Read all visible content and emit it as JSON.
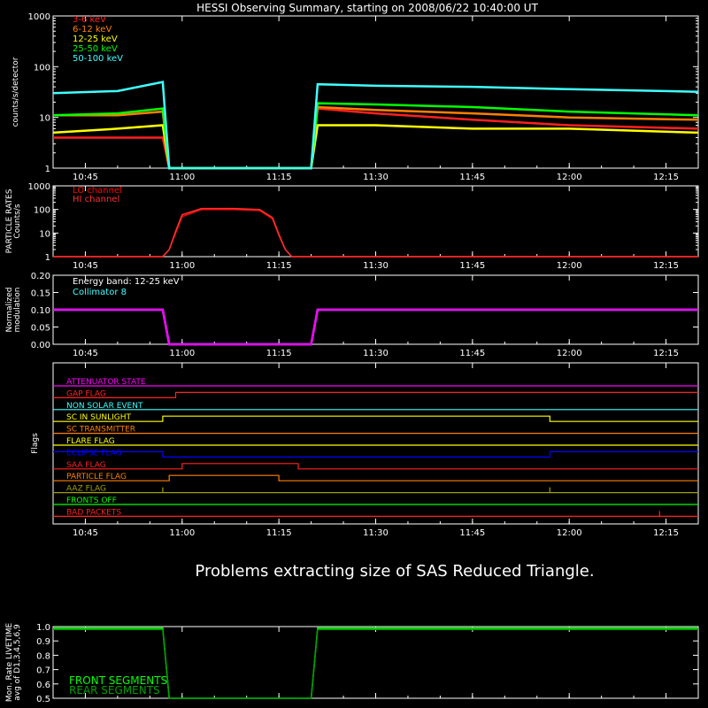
{
  "title": "HESSI Observing Summary, starting on 2008/06/22 10:40:00 UT",
  "notice": "Problems extracting size of SAS Reduced Triangle.",
  "time_ticks": [
    "10:45",
    "11:00",
    "11:15",
    "11:30",
    "11:45",
    "12:00",
    "12:15"
  ],
  "colors": {
    "axes": "#ffffff",
    "e3_6": "#ff2020",
    "e6_12": "#ff8000",
    "e12_25": "#ffff00",
    "e25_50": "#00ff00",
    "e50_100": "#40ffff",
    "particle_lo": "#ff0000",
    "particle_hi": "#ff3030",
    "mod_energy": "#40ffff",
    "mod_coll": "#ff00ff",
    "front_seg": "#00ff00",
    "rear_seg": "#00a000"
  },
  "chart_data": [
    {
      "type": "line",
      "ylabel": "counts/s/detector",
      "yscale": "log",
      "ylim": [
        1,
        1000
      ],
      "ytick_labels": [
        "1",
        "10",
        "100",
        "1000"
      ],
      "xlim": [
        "10:40",
        "12:20"
      ],
      "series": [
        {
          "name": "3-6 keV",
          "color": "#ff2020",
          "x": [
            "10:40",
            "10:50",
            "10:57",
            "10:58",
            "11:20",
            "11:21",
            "11:30",
            "11:45",
            "12:00",
            "12:20"
          ],
          "y": [
            4,
            4,
            4,
            1,
            1,
            15,
            12,
            9,
            7,
            6
          ]
        },
        {
          "name": "6-12 keV",
          "color": "#ff8000",
          "x": [
            "10:40",
            "10:50",
            "10:57",
            "10:58",
            "11:20",
            "11:21",
            "11:30",
            "11:45",
            "12:00",
            "12:20"
          ],
          "y": [
            11,
            11,
            13,
            1,
            1,
            16,
            14,
            12,
            10,
            9
          ]
        },
        {
          "name": "12-25 keV",
          "color": "#ffff00",
          "x": [
            "10:40",
            "10:50",
            "10:57",
            "10:58",
            "11:20",
            "11:21",
            "11:30",
            "11:45",
            "12:00",
            "12:20"
          ],
          "y": [
            5,
            6,
            7,
            1,
            1,
            7,
            7,
            6,
            6,
            5
          ]
        },
        {
          "name": "25-50 keV",
          "color": "#00ff00",
          "x": [
            "10:40",
            "10:50",
            "10:57",
            "10:58",
            "11:20",
            "11:21",
            "11:30",
            "11:45",
            "12:00",
            "12:20"
          ],
          "y": [
            11,
            12,
            15,
            1,
            1,
            19,
            18,
            16,
            13,
            11
          ]
        },
        {
          "name": "50-100 keV",
          "color": "#40ffff",
          "x": [
            "10:40",
            "10:50",
            "10:57",
            "10:58",
            "11:20",
            "11:21",
            "11:30",
            "11:45",
            "12:00",
            "12:20"
          ],
          "y": [
            30,
            33,
            50,
            1,
            1,
            45,
            42,
            40,
            36,
            32
          ]
        }
      ]
    },
    {
      "type": "line",
      "ylabel": "PARTICLE RATES Counts/s",
      "yscale": "log",
      "ylim": [
        1,
        1000
      ],
      "ytick_labels": [
        "1",
        "10",
        "100",
        "1000"
      ],
      "xlim": [
        "10:40",
        "12:20"
      ],
      "series": [
        {
          "name": "LO channel",
          "color": "#ff0000",
          "x": [
            "10:40",
            "10:57",
            "10:58",
            "10:59",
            "11:00",
            "11:03",
            "11:08",
            "11:12",
            "11:14",
            "11:15",
            "11:16",
            "11:17",
            "12:20"
          ],
          "y": [
            1,
            1,
            2,
            10,
            50,
            100,
            100,
            90,
            40,
            8,
            2,
            1,
            1
          ]
        },
        {
          "name": "HI channel",
          "color": "#ff3030",
          "x": [
            "10:40",
            "10:57",
            "10:58",
            "10:59",
            "11:00",
            "11:03",
            "11:08",
            "11:12",
            "11:14",
            "11:15",
            "11:16",
            "11:17",
            "12:20"
          ],
          "y": [
            1,
            1,
            2,
            12,
            60,
            110,
            110,
            100,
            45,
            9,
            2,
            1,
            1
          ]
        }
      ]
    },
    {
      "type": "line",
      "ylabel": "Normalized modulation",
      "ylim": [
        0,
        0.2
      ],
      "ytick_labels": [
        "0.00",
        "0.05",
        "0.10",
        "0.15",
        "0.20"
      ],
      "xlim": [
        "10:40",
        "12:20"
      ],
      "series": [
        {
          "name": "Energy band: 12-25 keV",
          "color": "#40ffff",
          "x": [
            "10:40",
            "10:57",
            "10:58",
            "11:20",
            "11:21",
            "12:20"
          ],
          "y": [
            0.1,
            0.1,
            0,
            0,
            0.1,
            0.1
          ]
        },
        {
          "name": "Collimator 8",
          "color": "#ff00ff",
          "x": [
            "10:40",
            "10:57",
            "10:58",
            "11:20",
            "11:21",
            "12:20"
          ],
          "y": [
            0.1,
            0.1,
            0,
            0,
            0.1,
            0.1
          ]
        }
      ]
    },
    {
      "type": "line",
      "ylabel": "Flags",
      "xlim": [
        "10:40",
        "12:20"
      ],
      "series": [
        {
          "name": "ATTENUATOR STATE",
          "color": "#ff00ff",
          "x": [
            "10:40",
            "12:20"
          ],
          "y": [
            0,
            0
          ]
        },
        {
          "name": "GAP FLAG",
          "color": "#ff2020",
          "x": [
            "10:40",
            "10:59",
            "10:59",
            "12:20"
          ],
          "y": [
            0,
            0,
            1,
            1
          ]
        },
        {
          "name": "NON SOLAR EVENT",
          "color": "#40ffff",
          "x": [
            "10:40",
            "12:20"
          ],
          "y": [
            0,
            0
          ]
        },
        {
          "name": "SC IN SUNLIGHT",
          "color": "#ffff00",
          "x": [
            "10:40",
            "10:57",
            "10:57",
            "11:57",
            "11:57",
            "12:20"
          ],
          "y": [
            0,
            0,
            1,
            1,
            0,
            0
          ]
        },
        {
          "name": "SC TRANSMITTER",
          "color": "#ff8000",
          "x": [
            "10:40",
            "12:20"
          ],
          "y": [
            0,
            0
          ]
        },
        {
          "name": "FLARE FLAG",
          "color": "#ffff00",
          "x": [
            "10:40",
            "12:20"
          ],
          "y": [
            0,
            0
          ]
        },
        {
          "name": "ECLIPSE FLAG",
          "color": "#0000ff",
          "x": [
            "10:40",
            "10:57",
            "10:57",
            "11:57",
            "11:57",
            "12:20"
          ],
          "y": [
            1,
            1,
            0,
            0,
            1,
            1
          ]
        },
        {
          "name": "SAA FLAG",
          "color": "#ff2020",
          "x": [
            "10:40",
            "11:00",
            "11:00",
            "11:18",
            "11:18",
            "12:20"
          ],
          "y": [
            0,
            0,
            1,
            1,
            0,
            0
          ]
        },
        {
          "name": "PARTICLE FLAG",
          "color": "#ff8000",
          "x": [
            "10:40",
            "10:58",
            "10:58",
            "11:15",
            "11:15",
            "12:20"
          ],
          "y": [
            0,
            0,
            1,
            1,
            0,
            0
          ]
        },
        {
          "name": "AAZ FLAG",
          "color": "#a0a000",
          "x": [
            "10:40",
            "10:57",
            "10:57",
            "10:57",
            "10:57",
            "11:57",
            "11:57",
            "11:57",
            "11:57",
            "12:20"
          ],
          "y": [
            0,
            0,
            1,
            1,
            0,
            0,
            1,
            1,
            0,
            0
          ]
        },
        {
          "name": "FRONTS OFF",
          "color": "#00ff00",
          "x": [
            "10:40",
            "12:20"
          ],
          "y": [
            0,
            0
          ]
        },
        {
          "name": "BAD PACKETS",
          "color": "#ff2020",
          "x": [
            "10:40",
            "12:14",
            "12:14",
            "12:14",
            "12:14",
            "12:20"
          ],
          "y": [
            0,
            0,
            1,
            1,
            0,
            0
          ]
        }
      ]
    },
    {
      "type": "line",
      "ylabel": "Mon. Rate LIVETIME avg of D1,3,4,5,6,9",
      "ylim": [
        0.5,
        1.0
      ],
      "ytick_labels": [
        "0.5",
        "0.6",
        "0.7",
        "0.8",
        "0.9",
        "1.0"
      ],
      "xlim": [
        "10:40",
        "12:20"
      ],
      "series": [
        {
          "name": "FRONT SEGMENTS",
          "color": "#00ff00",
          "x": [
            "10:40",
            "10:57",
            "10:58",
            "11:20",
            "11:21",
            "12:20"
          ],
          "y": [
            0.99,
            0.99,
            0.5,
            0.5,
            0.99,
            0.99
          ]
        },
        {
          "name": "REAR SEGMENTS",
          "color": "#00a000",
          "x": [
            "10:40",
            "10:57",
            "10:58",
            "11:20",
            "11:21",
            "12:20"
          ],
          "y": [
            0.98,
            0.98,
            0.5,
            0.5,
            0.98,
            0.98
          ]
        }
      ]
    }
  ]
}
